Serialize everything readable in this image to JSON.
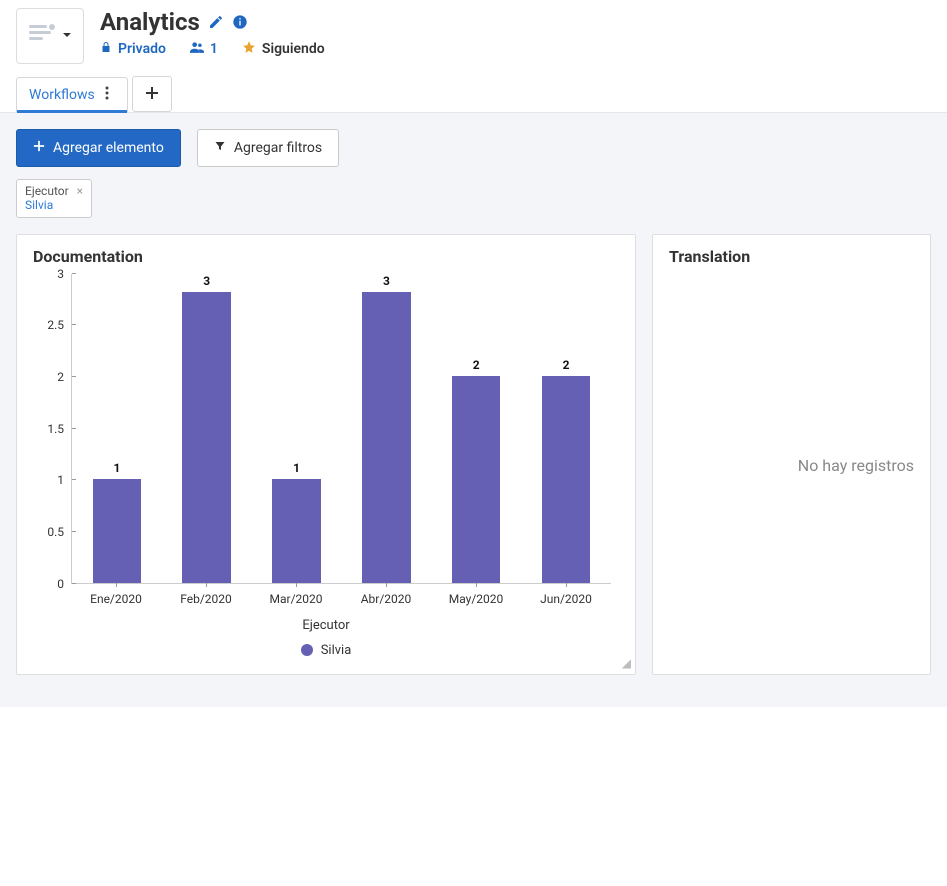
{
  "header": {
    "title": "Analytics",
    "privacy": "Privado",
    "member_count": "1",
    "follow_label": "Siguiendo"
  },
  "tabs": {
    "items": [
      {
        "label": "Workflows",
        "active": true
      }
    ]
  },
  "toolbar": {
    "add_element_label": "Agregar elemento",
    "add_filters_label": "Agregar filtros"
  },
  "filters": {
    "chips": [
      {
        "label": "Ejecutor",
        "value": "Silvia"
      }
    ]
  },
  "panels": {
    "left": {
      "title": "Documentation"
    },
    "right": {
      "title": "Translation",
      "empty_text": "No hay registros"
    }
  },
  "chart_data": {
    "type": "bar",
    "categories": [
      "Ene/2020",
      "Feb/2020",
      "Mar/2020",
      "Abr/2020",
      "May/2020",
      "Jun/2020"
    ],
    "values": [
      1,
      3,
      1,
      3,
      2,
      2
    ],
    "series": [
      {
        "name": "Silvia",
        "values": [
          1,
          3,
          1,
          3,
          2,
          2
        ],
        "color": "#6560b4"
      }
    ],
    "xlabel": "Ejecutor",
    "ylabel": "",
    "ylim": [
      0,
      3
    ],
    "yticks": [
      0,
      0.5,
      1,
      1.5,
      2,
      2.5,
      3
    ],
    "legend": {
      "entries": [
        "Silvia"
      ],
      "position": "bottom"
    }
  }
}
